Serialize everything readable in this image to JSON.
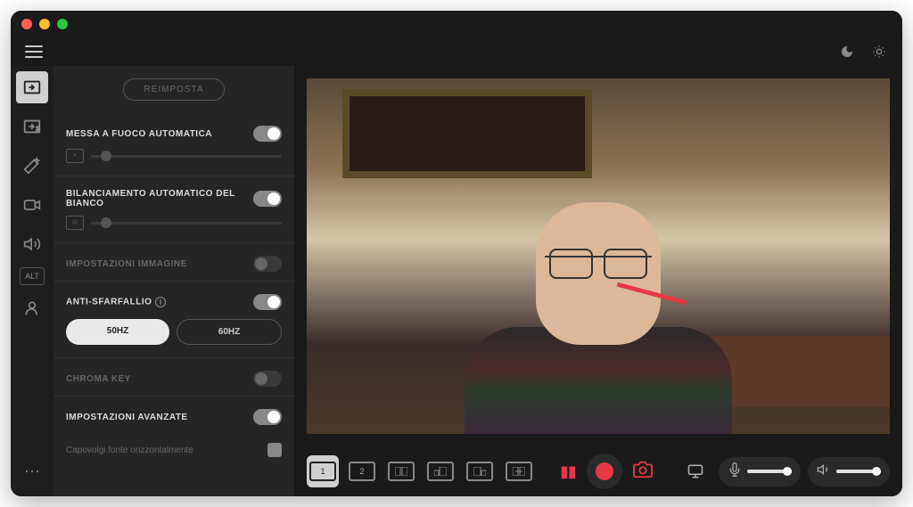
{
  "panel": {
    "reset_label": "REIMPOSTA",
    "autofocus_label": "MESSA A FUOCO AUTOMATICA",
    "autofocus_on": true,
    "white_balance_label": "BILANCIAMENTO AUTOMATICO DEL BIANCO",
    "white_balance_on": true,
    "image_settings_label": "IMPOSTAZIONI IMMAGINE",
    "image_settings_on": false,
    "anti_flicker_label": "ANTI-SFARFALLIO",
    "anti_flicker_on": true,
    "hz_50": "50HZ",
    "hz_60": "60HZ",
    "hz_selected": "50HZ",
    "chroma_key_label": "CHROMA KEY",
    "chroma_key_on": false,
    "advanced_label": "IMPOSTAZIONI AVANZATE",
    "advanced_on": true,
    "flip_label": "Capovolgi fonte orizzontalmente"
  },
  "layout_buttons": [
    "1",
    "2"
  ],
  "rail_items": [
    "input-1",
    "input-2",
    "magic-wand",
    "camera",
    "audio",
    "alt",
    "user"
  ]
}
